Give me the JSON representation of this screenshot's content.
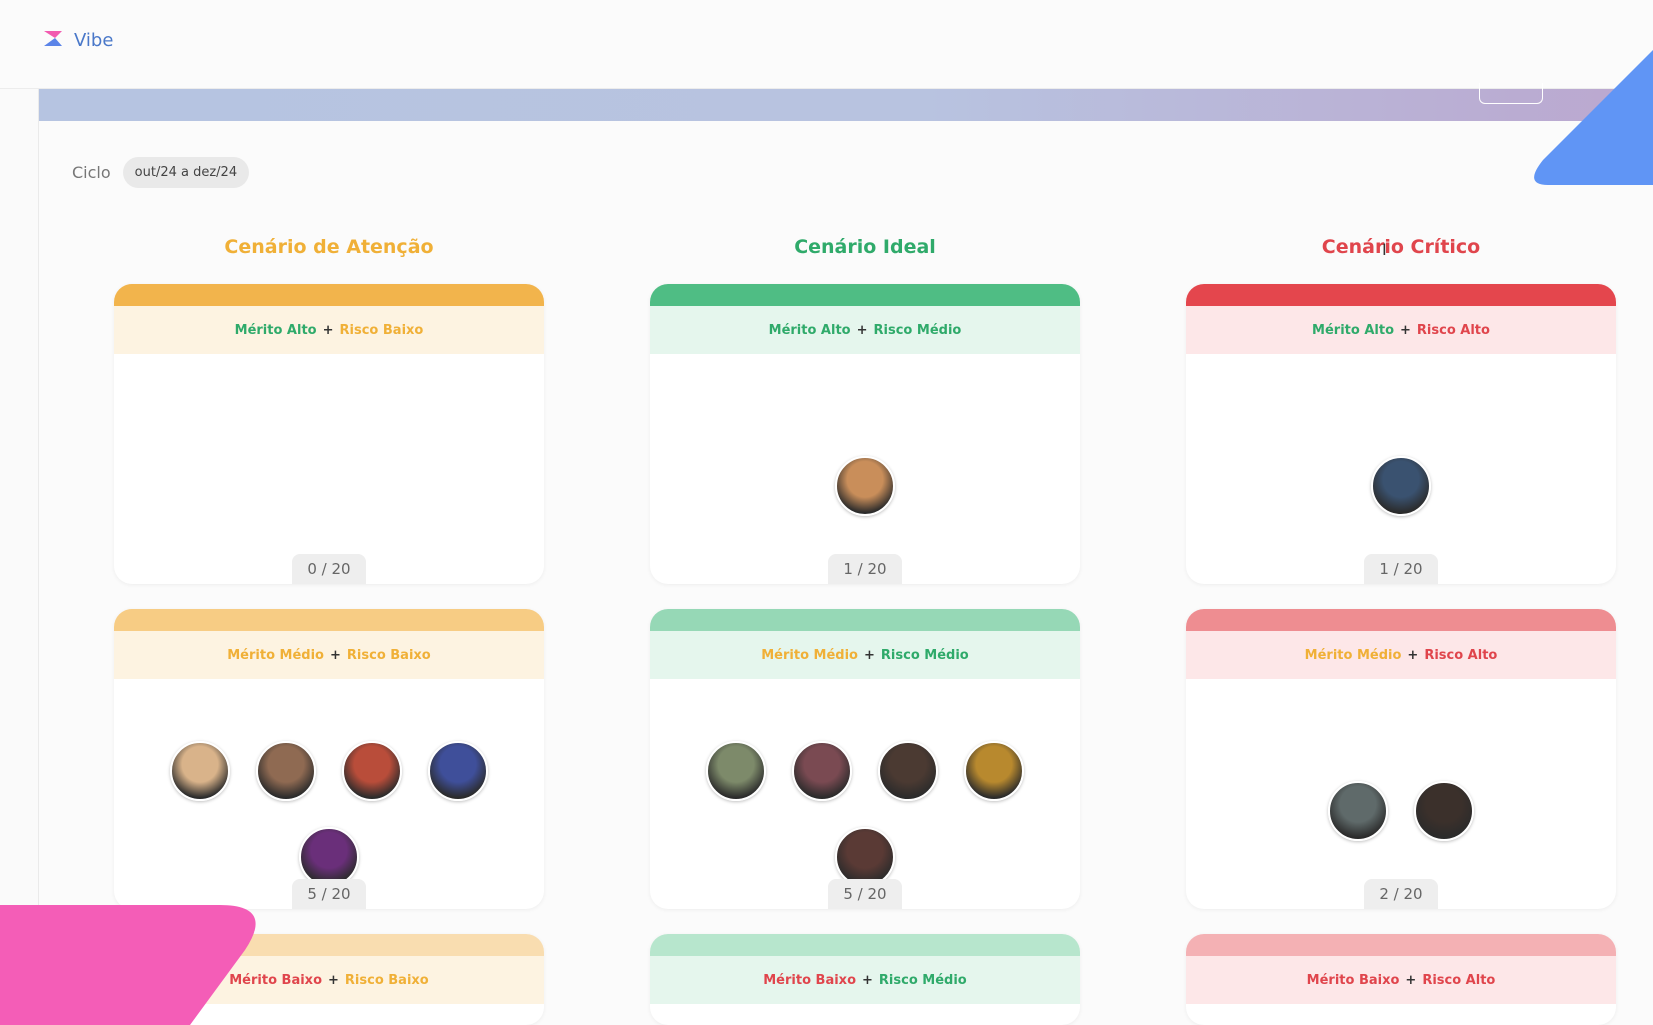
{
  "app": {
    "name": "Vibe"
  },
  "cycle": {
    "label": "Ciclo",
    "value": "out/24 a dez/24"
  },
  "columns": [
    {
      "title": "Cenário de Atenção",
      "color": "#f0b037"
    },
    {
      "title": "Cenário Ideal",
      "color": "#2faa6a"
    },
    {
      "title": "Cenário Crítico",
      "color": "#e0454c"
    }
  ],
  "rows": [
    [
      {
        "merit": "Mérito Alto",
        "risk": "Risco Baixo",
        "count": "0 / 20",
        "avatars": []
      },
      {
        "merit": "Mérito Alto",
        "risk": "Risco Médio",
        "count": "1 / 20",
        "avatars": [
          "thanos-avatar"
        ]
      },
      {
        "merit": "Mérito Alto",
        "risk": "Risco Alto",
        "count": "1 / 20",
        "avatars": [
          "aquaman-avatar"
        ]
      }
    ],
    [
      {
        "merit": "Mérito Médio",
        "risk": "Risco Baixo",
        "count": "5 / 20",
        "avatars": [
          "invisible-woman-avatar",
          "doctor-strange-avatar",
          "deadpool-avatar",
          "kang-avatar",
          "scarlet-witch-avatar"
        ]
      },
      {
        "merit": "Mérito Médio",
        "risk": "Risco Médio",
        "count": "5 / 20",
        "avatars": [
          "hulk-avatar",
          "gamora-avatar",
          "iron-man-avatar",
          "loki-avatar",
          "black-widow-avatar"
        ]
      },
      {
        "merit": "Mérito Médio",
        "risk": "Risco Alto",
        "count": "2 / 20",
        "avatars": [
          "hawkeye-avatar",
          "nick-fury-avatar"
        ]
      }
    ],
    [
      {
        "merit": "Mérito Baixo",
        "risk": "Risco Baixo"
      },
      {
        "merit": "Mérito Baixo",
        "risk": "Risco Médio"
      },
      {
        "merit": "Mérito Baixo",
        "risk": "Risco Alto"
      }
    ]
  ],
  "colors": {
    "merit_high": "#2faa6a",
    "merit_mid": "#f0b037",
    "merit_low": "#e0454c",
    "risk_low": "#f0b037",
    "risk_mid": "#2faa6a",
    "risk_high": "#e0454c"
  }
}
